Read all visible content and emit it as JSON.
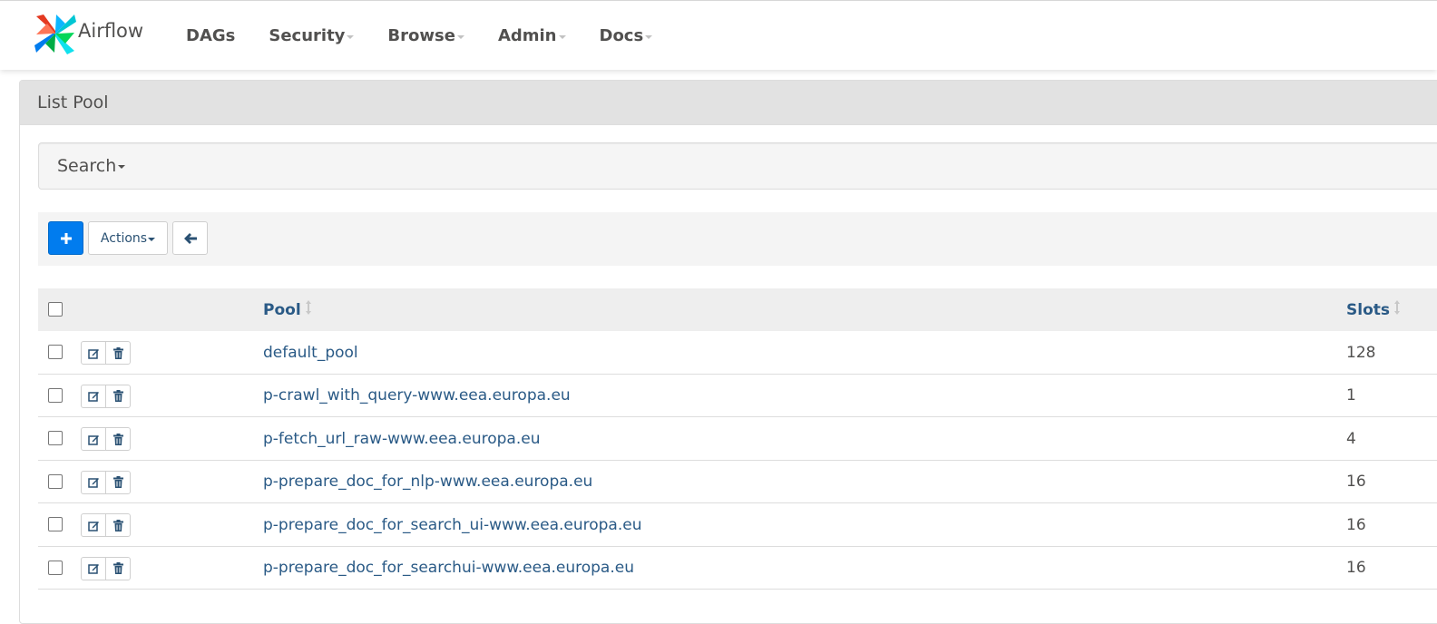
{
  "navbar": {
    "brand": "Airflow",
    "items": [
      {
        "label": "DAGs",
        "dropdown": false
      },
      {
        "label": "Security",
        "dropdown": true
      },
      {
        "label": "Browse",
        "dropdown": true
      },
      {
        "label": "Admin",
        "dropdown": true
      },
      {
        "label": "Docs",
        "dropdown": true
      }
    ]
  },
  "panel": {
    "title": "List Pool"
  },
  "search": {
    "label": "Search"
  },
  "toolbar": {
    "add_label": "+",
    "actions_label": "Actions",
    "back_icon": "arrow-left-icon"
  },
  "table": {
    "columns": [
      "Pool",
      "Slots"
    ],
    "rows": [
      {
        "pool": "default_pool",
        "slots": "128"
      },
      {
        "pool": "p-crawl_with_query-www.eea.europa.eu",
        "slots": "1"
      },
      {
        "pool": "p-fetch_url_raw-www.eea.europa.eu",
        "slots": "4"
      },
      {
        "pool": "p-prepare_doc_for_nlp-www.eea.europa.eu",
        "slots": "16"
      },
      {
        "pool": "p-prepare_doc_for_search_ui-www.eea.europa.eu",
        "slots": "16"
      },
      {
        "pool": "p-prepare_doc_for_searchui-www.eea.europa.eu",
        "slots": "16"
      }
    ]
  },
  "colors": {
    "primary": "#017cee",
    "link": "#2a5a86",
    "text": "#51504f"
  }
}
